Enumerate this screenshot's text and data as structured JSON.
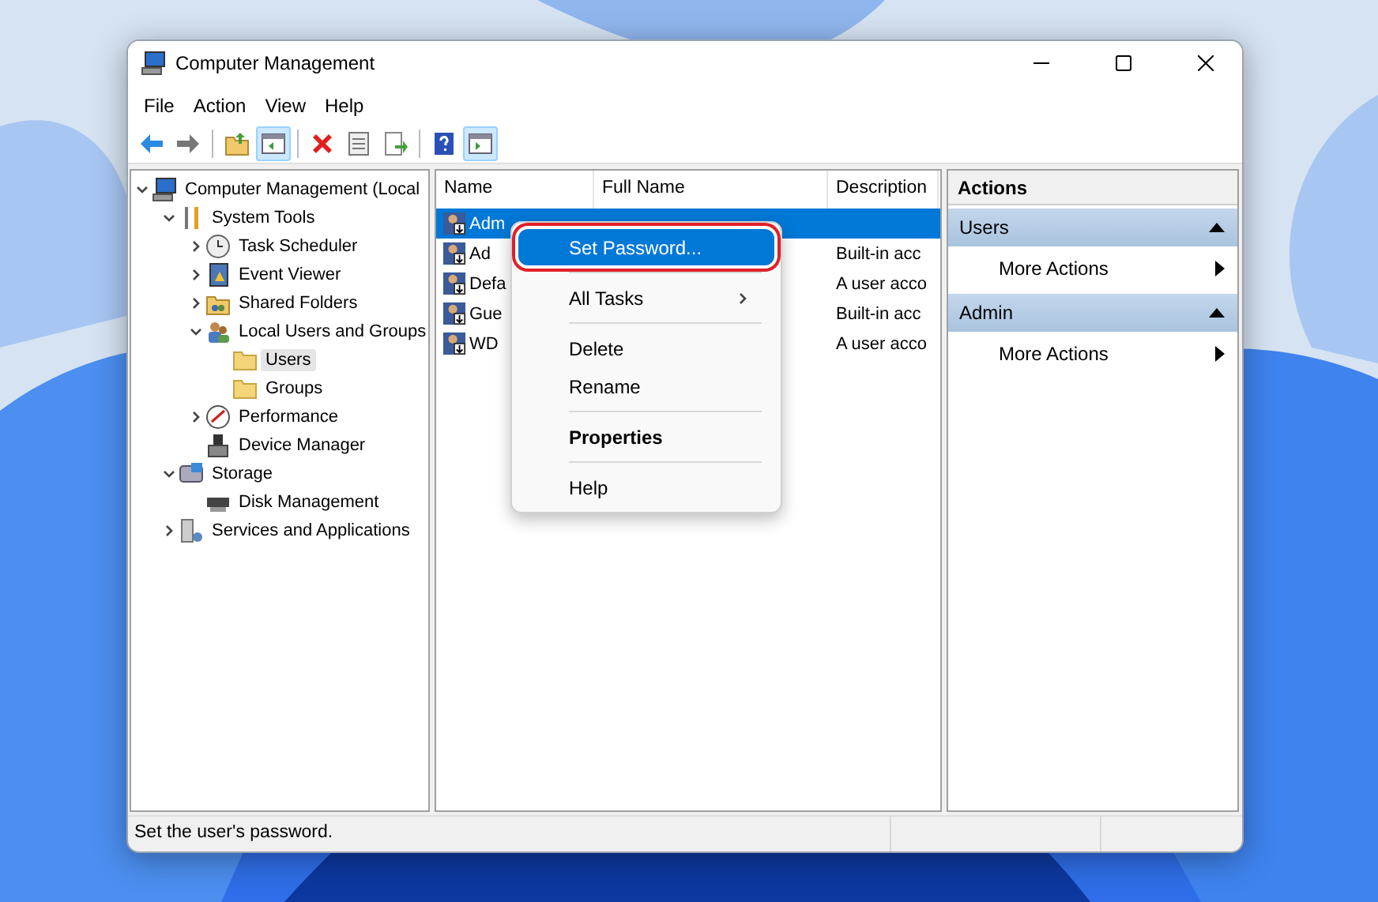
{
  "window": {
    "title": "Computer Management"
  },
  "menu": [
    "File",
    "Action",
    "View",
    "Help"
  ],
  "toolbar": [
    {
      "kind": "back"
    },
    {
      "kind": "forward"
    },
    {
      "kind": "sep"
    },
    {
      "kind": "up",
      "on": false
    },
    {
      "kind": "tree-toggle",
      "on": true
    },
    {
      "kind": "sep"
    },
    {
      "kind": "delete"
    },
    {
      "kind": "properties"
    },
    {
      "kind": "export"
    },
    {
      "kind": "sep"
    },
    {
      "kind": "help"
    },
    {
      "kind": "pane-toggle",
      "on": true
    }
  ],
  "tree": [
    {
      "label": "Computer Management (Local",
      "kind": "computer",
      "expanded": true,
      "selected": false,
      "children": [
        {
          "label": "System Tools",
          "kind": "tools",
          "expanded": true,
          "selected": false,
          "children": [
            {
              "label": "Task Scheduler",
              "kind": "clock",
              "expanded": false,
              "selected": false
            },
            {
              "label": "Event Viewer",
              "kind": "log",
              "expanded": false,
              "selected": false
            },
            {
              "label": "Shared Folders",
              "kind": "share",
              "expanded": false,
              "selected": false
            },
            {
              "label": "Local Users and Groups",
              "kind": "users",
              "expanded": true,
              "selected": false,
              "children": [
                {
                  "label": "Users",
                  "kind": "folder",
                  "selected": true
                },
                {
                  "label": "Groups",
                  "kind": "folder",
                  "selected": false
                }
              ]
            },
            {
              "label": "Performance",
              "kind": "gauge",
              "expanded": false,
              "selected": false
            },
            {
              "label": "Device Manager",
              "kind": "device",
              "selected": false
            }
          ]
        },
        {
          "label": "Storage",
          "kind": "storage",
          "expanded": true,
          "selected": false,
          "children": [
            {
              "label": "Disk Management",
              "kind": "disk",
              "selected": false
            }
          ]
        },
        {
          "label": "Services and Applications",
          "kind": "services",
          "expanded": false,
          "selected": false
        }
      ]
    }
  ],
  "list": {
    "columns": [
      "Name",
      "Full Name",
      "Description"
    ],
    "rows": [
      {
        "name": "Adm",
        "description": "",
        "selected": true
      },
      {
        "name": "Ad",
        "description": "Built-in acc",
        "selected": false
      },
      {
        "name": "Defa",
        "description": "A user acco",
        "selected": false
      },
      {
        "name": "Gue",
        "description": "Built-in acc",
        "selected": false
      },
      {
        "name": "WD",
        "description": "A user acco",
        "selected": false
      }
    ]
  },
  "context_menu": {
    "groups": [
      [
        {
          "label": "Set Password...",
          "selected": true,
          "circled": true
        }
      ],
      [
        {
          "label": "All Tasks",
          "submenu": true,
          "selected": false
        }
      ],
      [
        {
          "label": "Delete",
          "selected": false
        },
        {
          "label": "Rename",
          "selected": false
        }
      ],
      [
        {
          "label": "Properties",
          "default": true,
          "selected": false
        }
      ],
      [
        {
          "label": "Help",
          "selected": false
        }
      ]
    ]
  },
  "actions": {
    "title": "Actions",
    "sections": [
      {
        "title": "Users",
        "expanded": true,
        "items": [
          "More Actions"
        ]
      },
      {
        "title": "Admin",
        "expanded": true,
        "items": [
          "More Actions"
        ]
      }
    ]
  },
  "status_bar": "Set the user's password."
}
